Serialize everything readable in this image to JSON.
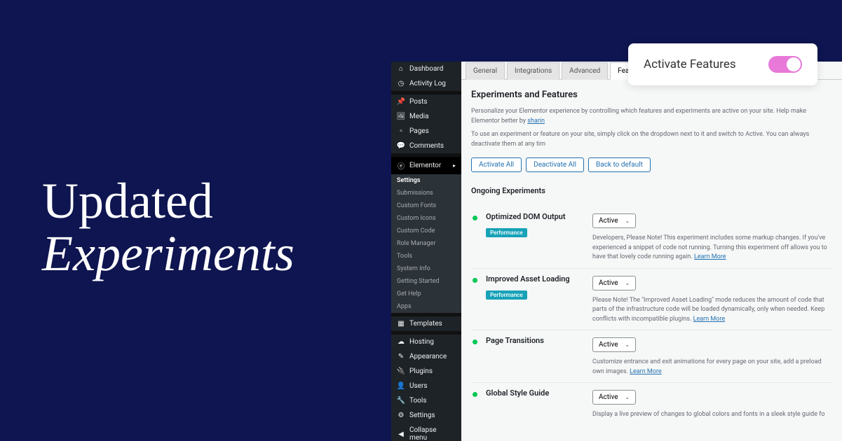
{
  "hero": {
    "line1": "Updated",
    "line2": "Experiments"
  },
  "toast": {
    "label": "Activate Features"
  },
  "sidebar": {
    "dashboard": "Dashboard",
    "activity": "Activity Log",
    "posts": "Posts",
    "media": "Media",
    "pages": "Pages",
    "comments": "Comments",
    "elementor": "Elementor",
    "templates": "Templates",
    "hosting": "Hosting",
    "appearance": "Appearance",
    "plugins": "Plugins",
    "users": "Users",
    "tools": "Tools",
    "settings": "Settings",
    "collapse": "Collapse menu",
    "sub": {
      "settings": "Settings",
      "submissions": "Submissions",
      "customfonts": "Custom Fonts",
      "customicons": "Custom Icons",
      "customcode": "Custom Code",
      "rolemanager": "Role Manager",
      "tools": "Tools",
      "systeminfo": "System Info",
      "gettingstarted": "Getting Started",
      "gethelp": "Get Help",
      "apps": "Apps"
    }
  },
  "tabs": {
    "general": "General",
    "integrations": "Integrations",
    "advanced": "Advanced",
    "features": "Features"
  },
  "page": {
    "title": "Experiments and Features",
    "desc1a": "Personalize your Elementor experience by controlling which features and experiments are active on your site. Help make Elementor better by ",
    "desc1link": "sharin",
    "desc2": "To use an experiment or feature on your site, simply click on the dropdown next to it and switch to Active. You can always deactivate them at any tim",
    "activateAll": "Activate All",
    "deactivateAll": "Deactivate All",
    "backDefault": "Back to default",
    "ongoing": "Ongoing Experiments"
  },
  "select": {
    "active": "Active"
  },
  "exp": [
    {
      "title": "Optimized DOM Output",
      "badge": "Performance",
      "desc": "Developers, Please Note! This experiment includes some markup changes. If you've experienced a snippet of code not running. Turning this experiment off allows you to have that lovely code running again. ",
      "link": "Learn More"
    },
    {
      "title": "Improved Asset Loading",
      "badge": "Performance",
      "desc": "Please Note! The \"Improved Asset Loading\" mode reduces the amount of code that parts of the infrastructure code will be loaded dynamically, only when needed. Keep conflicts with incompatible plugins. ",
      "link": "Learn More"
    },
    {
      "title": "Page Transitions",
      "badge": "",
      "desc": "Customize entrance and exit animations for every page on your site, add a preload own images. ",
      "link": "Learn More"
    },
    {
      "title": "Global Style Guide",
      "badge": "",
      "desc": "Display a live preview of changes to global colors and fonts in a sleek style guide fo",
      "link": ""
    }
  ]
}
